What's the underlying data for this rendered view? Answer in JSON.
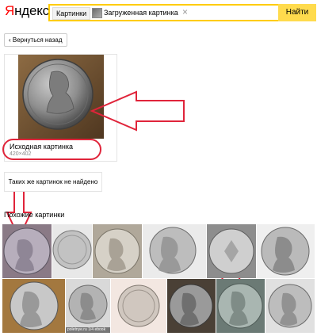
{
  "header": {
    "logo_first": "Я",
    "logo_rest": "ндекс",
    "search_tab": "Картинки",
    "search_value": "Загруженная картинка",
    "clear": "×",
    "search_button": "Найти"
  },
  "back_button": "‹ Вернуться назад",
  "source": {
    "label": "Исходная картинка",
    "size": "420×402"
  },
  "not_found": "Таких же картинок не найдено",
  "similar": {
    "title": "Похожие картинки",
    "caption": "poletnye.ru 1/4 ebook"
  },
  "colors": {
    "accent": "#ffdb4d",
    "annotation": "#e0243a",
    "logo_red": "#ff0000"
  }
}
